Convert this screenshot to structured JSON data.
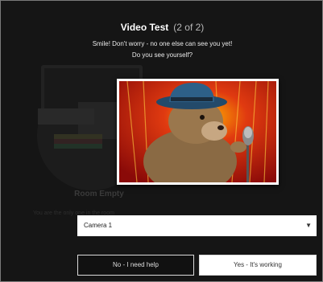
{
  "dialog": {
    "title": "Video Test",
    "step": "(2 of 2)",
    "line1": "Smile! Don't worry - no one else can see you yet!",
    "line2": "Do you see yourself?"
  },
  "background": {
    "room_title": "Room Empty",
    "room_subtitle": "You are the only one in the room"
  },
  "camera_select": {
    "selected": "Camera 1",
    "chevron_icon": "chevron-down-icon"
  },
  "buttons": {
    "help": "No - I need help",
    "yes": "Yes - It's working"
  }
}
